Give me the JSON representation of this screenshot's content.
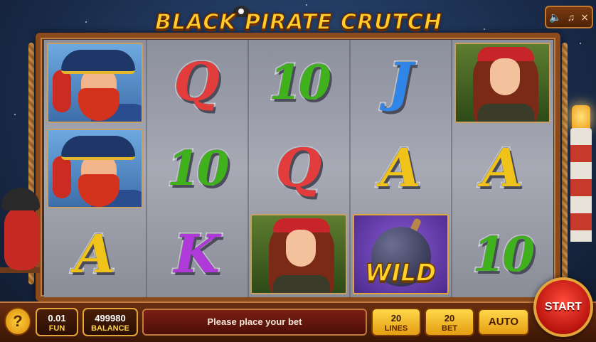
{
  "game": {
    "title": "BLACK PIRATE CRUTCH"
  },
  "top_controls": {
    "sound_icon": "speaker-icon",
    "music_icon": "music-note-icon",
    "fullscreen_icon": "fullscreen-icon"
  },
  "reels": [
    [
      "captain",
      "Q",
      "10",
      "J",
      "lady"
    ],
    [
      "captain",
      "10",
      "Q",
      "A",
      "A"
    ],
    [
      "A",
      "K",
      "lady",
      "wild",
      "10"
    ]
  ],
  "symbols": {
    "Q": "Q",
    "10": "10",
    "J": "J",
    "A": "A",
    "K": "K",
    "wild_label": "WILD"
  },
  "bottom_bar": {
    "help_label": "?",
    "coin_value": "0.01",
    "coin_label": "FUN",
    "balance_value": "499980",
    "balance_label": "BALANCE",
    "message": "Please place your bet",
    "lines_value": "20",
    "lines_label": "LINES",
    "bet_value": "20",
    "bet_label": "BET",
    "auto_label": "AUTO",
    "start_label": "START"
  }
}
